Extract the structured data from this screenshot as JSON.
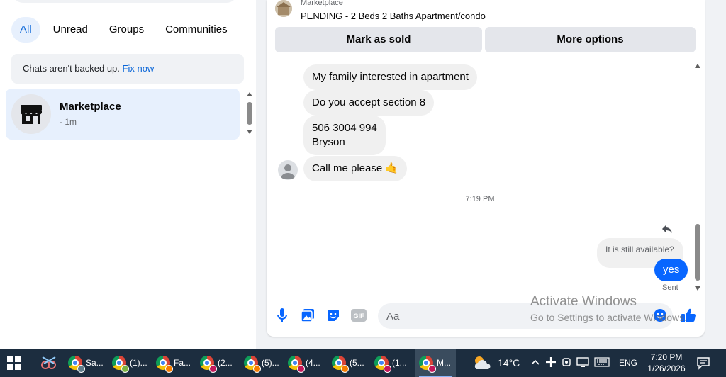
{
  "sidebar": {
    "filters": [
      {
        "label": "All",
        "active": true
      },
      {
        "label": "Unread",
        "active": false
      },
      {
        "label": "Groups",
        "active": false
      },
      {
        "label": "Communities",
        "active": false
      }
    ],
    "notice": {
      "text": "Chats aren't backed up.",
      "link": "Fix now"
    },
    "chats": [
      {
        "name": "Marketplace",
        "time": "· 1m",
        "icon": "storefront-icon"
      }
    ]
  },
  "conversation": {
    "listing": {
      "category": "Marketplace",
      "title": "PENDING - 2 Beds 2 Baths Apartment/condo"
    },
    "actions": {
      "mark_sold": "Mark as sold",
      "more_options": "More options"
    },
    "messages": [
      {
        "text": "My family  interested in apartment"
      },
      {
        "text": "Do you accept section 8"
      },
      {
        "line1": "506 3004 994",
        "line2": "Bryson"
      },
      {
        "text": "Call me please 🤙"
      }
    ],
    "timestamp": "7:19 PM",
    "reply": {
      "quoted": "It is still available?",
      "text": "yes",
      "status": "Sent"
    },
    "composer": {
      "placeholder": "Aa",
      "tools": [
        "microphone-icon",
        "image-icon",
        "sticker-icon",
        "gif-icon"
      ],
      "emoji_icon": "emoji-icon",
      "like_icon": "thumbs-up-icon"
    },
    "accent_color": "#0866ff"
  },
  "watermark": {
    "line1": "Activate Windows",
    "line2": "Go to Settings to activate Windows."
  },
  "taskbar": {
    "apps": [
      {
        "label": "Sa...",
        "badge": "gr"
      },
      {
        "label": "(1)...",
        "badge": "g"
      },
      {
        "label": "Fa...",
        "badge": "o"
      },
      {
        "label": "(2...",
        "badge": ""
      },
      {
        "label": "(5)...",
        "badge": "o"
      },
      {
        "label": "(4...",
        "badge": ""
      },
      {
        "label": "(5...",
        "badge": "o"
      },
      {
        "label": "(1...",
        "badge": ""
      },
      {
        "label": "M...",
        "badge": "",
        "active": true
      }
    ],
    "weather": "14°C",
    "language": "ENG",
    "time": "7:20 PM",
    "date": "1/26/2026"
  }
}
